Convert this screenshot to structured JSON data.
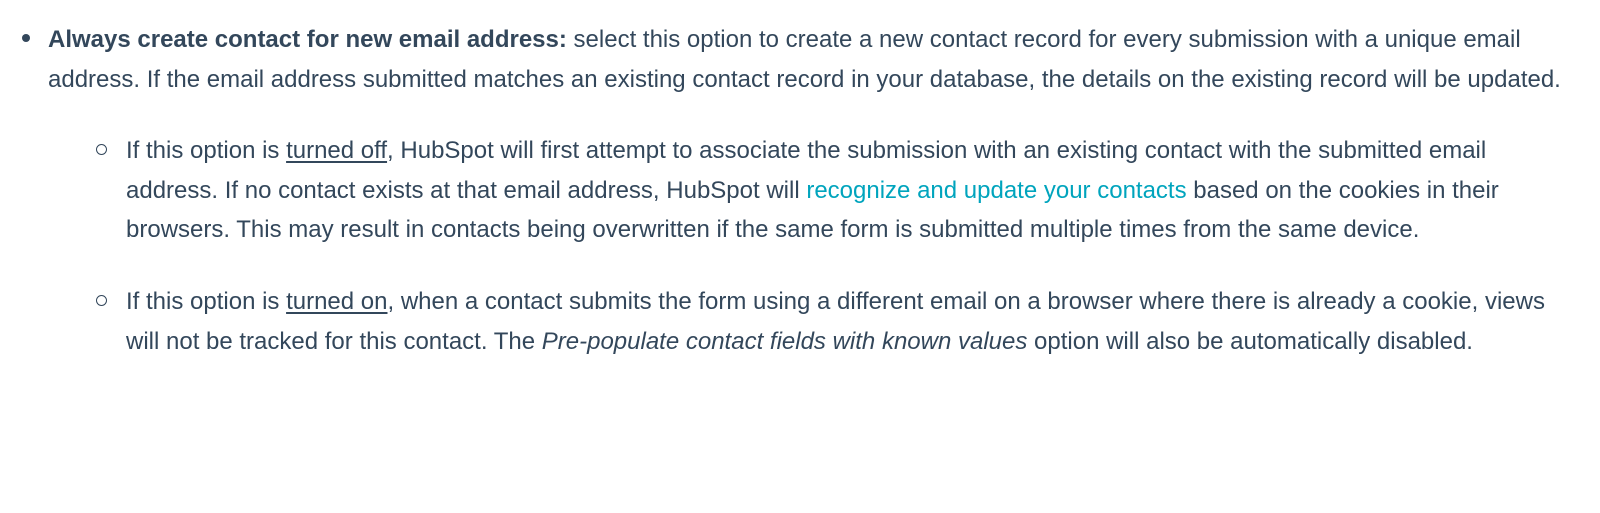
{
  "main": {
    "bold_label": "Always create contact for new email address:",
    "description": " select this option to create a new contact record for every submission with a unique email address. If the email address submitted matches an existing contact record in your database, the details on the existing record will be updated."
  },
  "sub_off": {
    "prefix": "If this option is ",
    "state": "turned off",
    "mid1": ", HubSpot will first attempt to associate the submission with an existing contact with the submitted email address. If no contact exists at that email address, HubSpot will ",
    "link_text": "recognize and update your contacts",
    "mid2": " based on the cookies in their browsers. This may result in contacts being overwritten if the same form is submitted multiple times from the same device."
  },
  "sub_on": {
    "prefix": "If this option is ",
    "state": "turned on",
    "mid1": ", when a contact submits the form using a different email on a browser where there is already a cookie, views will not be tracked for this contact. The ",
    "italic_text": "Pre-populate contact fields with known values",
    "mid2": " option will also be automatically disabled."
  }
}
